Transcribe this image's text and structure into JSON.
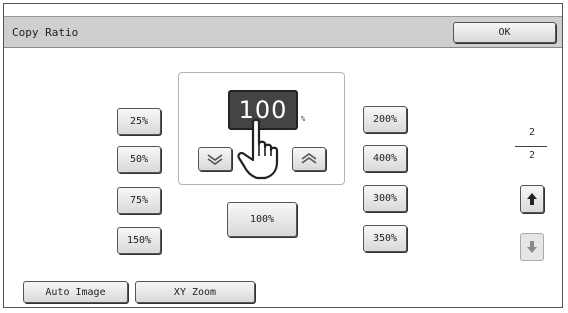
{
  "header": {
    "title": "Copy Ratio",
    "ok_label": "OK"
  },
  "display": {
    "value": "100",
    "unit": "%"
  },
  "ratios_left": [
    "25%",
    "50%",
    "75%",
    "150%"
  ],
  "ratios_right": [
    "200%",
    "400%",
    "300%",
    "350%"
  ],
  "reset_label": "100%",
  "pager": {
    "current": "2",
    "total": "2"
  },
  "bottom": {
    "auto_image": "Auto Image",
    "xy_zoom": "XY Zoom"
  },
  "icons": {
    "decrease": "chevron-down-double-icon",
    "increase": "chevron-up-double-icon",
    "pointer": "hand-pointer-icon",
    "page_up": "arrow-up-icon",
    "page_down": "arrow-down-icon"
  }
}
